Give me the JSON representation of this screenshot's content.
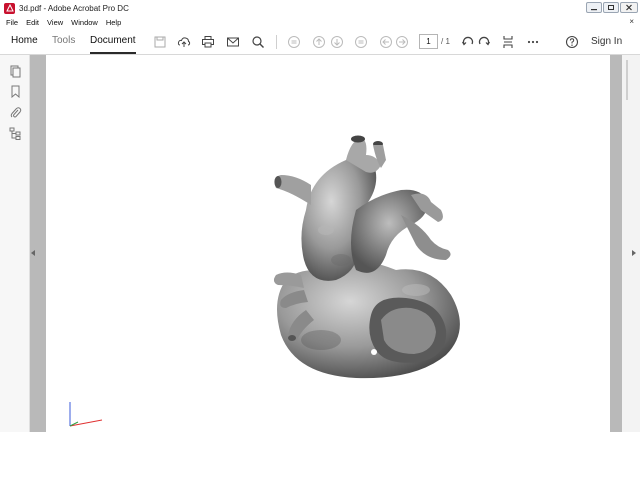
{
  "window": {
    "title": "3d.pdf - Adobe Acrobat Pro DC",
    "controls": [
      "minimize",
      "restore",
      "close"
    ]
  },
  "menu": [
    "File",
    "Edit",
    "View",
    "Window",
    "Help"
  ],
  "tabs": {
    "home": "Home",
    "tools": "Tools",
    "document": "Document"
  },
  "toolbar": {
    "icons": [
      "save-icon",
      "upload-icon",
      "print-icon",
      "email-icon",
      "search-icon",
      "fit-icon",
      "prev-page-icon",
      "next-page-icon",
      "page-view-icon",
      "back-icon",
      "forward-icon",
      "rotate-ccw-icon",
      "rotate-cw-icon",
      "marquee-zoom-icon",
      "more-icon",
      "help-icon"
    ],
    "page_number": "1",
    "page_total": "/ 1",
    "sign_in": "Sign In"
  },
  "left_pane": {
    "icons": [
      "page-thumbnails-icon",
      "bookmarks-icon",
      "attachments-icon",
      "model-tree-icon"
    ]
  },
  "document": {
    "content": "3d-heart-model",
    "model_color": "#8a8a8a"
  }
}
